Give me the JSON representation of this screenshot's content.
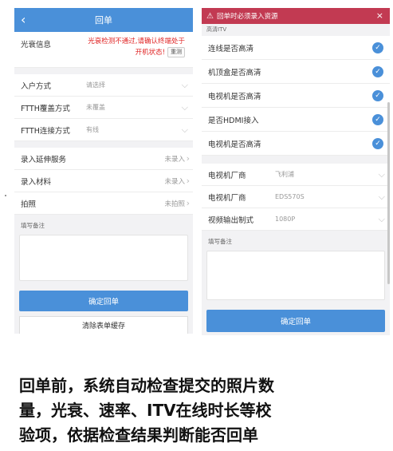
{
  "left": {
    "header": {
      "title": "回单"
    },
    "optical": {
      "label": "光衰信息",
      "warning": "光衰检测不通过,请确认终端处于开机状态!",
      "recheck_label": "重测"
    },
    "fields": [
      {
        "label": "入户方式",
        "value": "请选择"
      },
      {
        "label": "FTTH覆盖方式",
        "value": "未覆盖"
      },
      {
        "label": "FTTH连接方式",
        "value": "有线"
      }
    ],
    "entries": [
      {
        "label": "录入延伸服务",
        "status": "未录入"
      },
      {
        "label": "录入材料",
        "status": "未录入"
      },
      {
        "label": "拍照",
        "status": "未拍照"
      }
    ],
    "remark_label": "填写备注",
    "confirm_label": "确定回单",
    "clear_label": "清除表单缓存"
  },
  "right": {
    "alert": {
      "text": "回单时必须录入资源",
      "close": "×"
    },
    "itv_title": "高清ITV",
    "checks": [
      {
        "label": "连线是否高清"
      },
      {
        "label": "机顶盒是否高清"
      },
      {
        "label": "电视机是否高清"
      },
      {
        "label": "是否HDMI接入"
      },
      {
        "label": "电视机是否高清"
      }
    ],
    "selects": [
      {
        "label": "电视机厂商",
        "value": "飞利浦"
      },
      {
        "label": "电视机厂商",
        "value": "EDS570S"
      },
      {
        "label": "视频输出制式",
        "value": "1080P"
      }
    ],
    "remark_label": "填写备注",
    "confirm_label": "确定回单"
  },
  "caption": {
    "line1": "回单前，系统自动检查提交的照片数",
    "line2": "量，光衰、速率、ITV在线时长等校",
    "line3": "验项，依据检查结果判断能否回单"
  },
  "colors": {
    "primary": "#4a90d9",
    "danger": "#e02424",
    "alert_bg": "#c23a52"
  },
  "icons": {
    "back": "chevron-left-icon",
    "check": "check-circle-icon",
    "chevron": "chevron-down-icon",
    "arrow": "chevron-right-icon",
    "warn": "warning-icon",
    "close": "close-icon"
  }
}
